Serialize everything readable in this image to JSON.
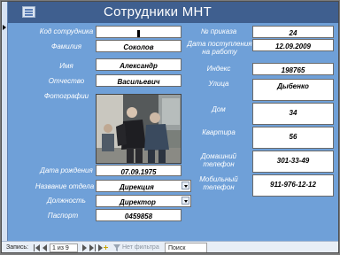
{
  "form": {
    "title": "Сотрудники МНТ",
    "labels": {
      "code": "Код сотрудника",
      "last_name": "Фамилия",
      "first_name": "Имя",
      "patronymic": "Отчество",
      "photo": "Фотографии",
      "birth_date": "Дата рождения",
      "department": "Название отдела",
      "position": "Должность",
      "passport": "Паспорт",
      "order_no": "№ приказа",
      "hire_date": "Дата поступления на работу",
      "zip": "Индекс",
      "street": "Улица",
      "house": "Дом",
      "apartment": "Квартира",
      "home_phone": "Домашний телефон",
      "mobile_phone": "Мобильный телефон"
    },
    "values": {
      "code": "",
      "last_name": "Соколов",
      "first_name": "Александр",
      "patronymic": "Васильевич",
      "birth_date": "07.09.1975",
      "department": "Дирекция",
      "position": "Директор",
      "passport": "0459858",
      "order_no": "24",
      "hire_date": "12.09.2009",
      "zip": "198765",
      "street": "Дыбенко",
      "house": "34",
      "apartment": "56",
      "home_phone": "301-33-49",
      "mobile_phone": "911-976-12-12"
    }
  },
  "nav": {
    "record_label": "Запись:",
    "position": "1 из 9",
    "filter_label": "Нет фильтра",
    "search_placeholder": "Поиск"
  },
  "colors": {
    "header": "#3f5f8f",
    "background": "#6fa0d8"
  }
}
